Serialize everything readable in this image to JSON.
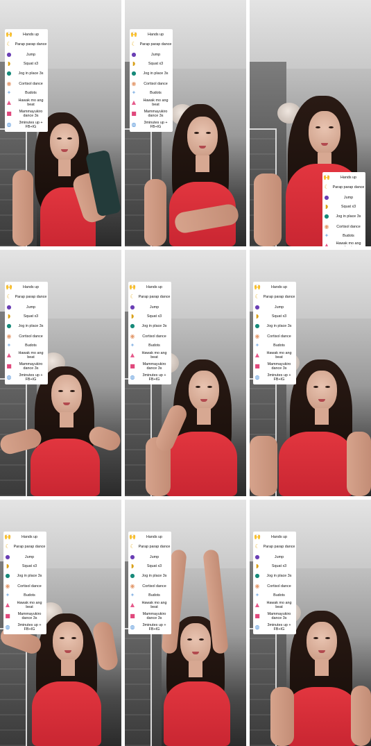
{
  "menu": {
    "items": [
      {
        "label": "Hands up",
        "icon": "raised-hands-icon",
        "glyph": "🙌",
        "color": "#6b4cc7"
      },
      {
        "label": "Parap parap dance",
        "icon": "crescent-moon-icon",
        "glyph": "☾",
        "color": "#e8b431"
      },
      {
        "label": "Jump",
        "icon": "purple-character-icon",
        "glyph": "●",
        "color": "#6a3fb5"
      },
      {
        "label": "Squat x3",
        "icon": "banana-icon",
        "glyph": "◗",
        "color": "#d8a11b"
      },
      {
        "label": "Jog in place 3s",
        "icon": "teal-monster-icon",
        "glyph": "●",
        "color": "#178a7a"
      },
      {
        "label": "Cortisol dance",
        "icon": "peach-swirl-icon",
        "glyph": "◉",
        "color": "#e49b6f"
      },
      {
        "label": "Budots",
        "icon": "blue-sparkle-icon",
        "glyph": "✦",
        "color": "#8db8e6"
      },
      {
        "label": "Hawak mo ang beat",
        "icon": "cake-icon",
        "glyph": "▲",
        "color": "#e65a8b"
      },
      {
        "label": "Mammayukiro dance 3s",
        "icon": "gift-box-icon",
        "glyph": "■",
        "color": "#e0487c"
      },
      {
        "label": "3minutes up + FB+IG",
        "icon": "planet-icon",
        "glyph": "◍",
        "color": "#4a8fd8"
      }
    ]
  },
  "palette": {
    "top": "#d8303a",
    "hair": "#1e120d",
    "skin": "#d9ab95",
    "wall": "#bdbdbd"
  }
}
